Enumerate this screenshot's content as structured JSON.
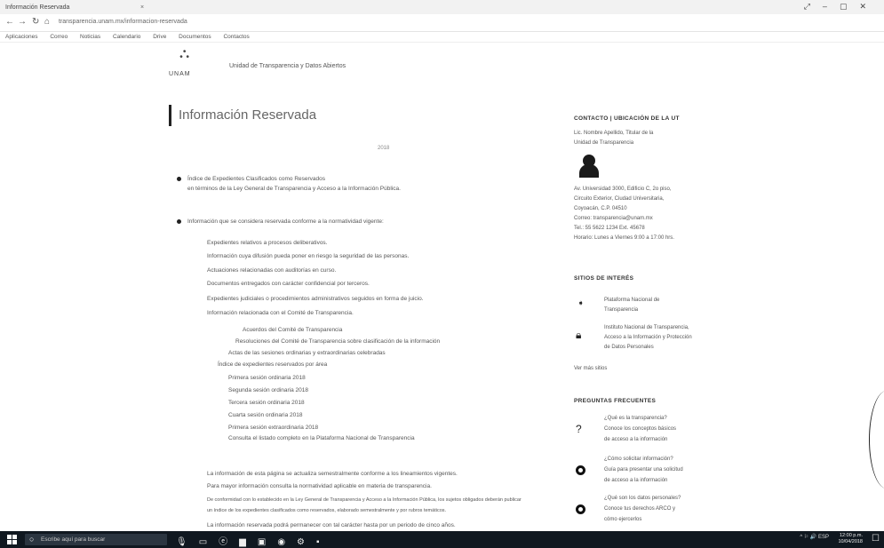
{
  "browser": {
    "tab_title": "Información Reservada",
    "tab_close": "×",
    "window_controls": [
      "⤢",
      "–",
      "▢",
      "✕"
    ],
    "nav": {
      "back": "←",
      "forward": "→",
      "reload": "↻",
      "home": "⌂"
    },
    "url": "transparencia.unam.mx/informacion-reservada",
    "bookmarks": [
      "Aplicaciones",
      "Correo",
      "Noticias",
      "Calendario",
      "Drive",
      "Documentos",
      "Contactos"
    ]
  },
  "header": {
    "logo_text": "UNAM",
    "site_title": "Unidad de Transparencia y Datos Abiertos"
  },
  "page": {
    "title": "Información Reservada",
    "date": "2018",
    "block1": [
      "Índice de Expedientes Clasificados como Reservados",
      "en términos de la Ley General de Transparencia y Acceso a la Información Pública."
    ],
    "block2": "Información que se considera reservada conforme a la normatividad vigente:",
    "lines": [
      "Expedientes relativos a procesos deliberativos.",
      "Información cuya difusión pueda poner en riesgo la seguridad de las personas.",
      "Actuaciones relacionadas con auditorías en curso.",
      "Documentos entregados con carácter confidencial por terceros.",
      "Expedientes judiciales o procedimientos administrativos seguidos en forma de juicio.",
      "Información relacionada con el Comité de Transparencia."
    ],
    "sub_lines": [
      "Acuerdos del Comité de Transparencia",
      "Resoluciones del Comité de Transparencia sobre clasificación de la información",
      "Actas de las sesiones ordinarias y extraordinarias celebradas",
      "Índice de expedientes reservados por área",
      "Primera sesión ordinaria 2018",
      "Segunda sesión ordinaria 2018",
      "Tercera sesión ordinaria 2018",
      "Cuarta sesión ordinaria 2018",
      "Primera sesión extraordinaria 2018",
      "Consulta el listado completo en la Plataforma Nacional de Transparencia"
    ],
    "footer_lines": [
      "La información de esta página se actualiza semestralmente conforme a los lineamientos vigentes.",
      "Para mayor información consulta la normatividad aplicable en materia de transparencia.",
      "De conformidad con lo establecido en la Ley General de Transparencia y Acceso a la Información Pública, los sujetos obligados deberán publicar",
      "un índice de los expedientes clasificados como reservados, elaborado semestralmente y por rubros temáticos.",
      "La información reservada podrá permanecer con tal carácter hasta por un periodo de cinco años."
    ]
  },
  "sidebar": {
    "contact_heading": "CONTACTO | UBICACIÓN DE LA UT",
    "contact_name": "Lic. Nombre Apellido, Titular de la",
    "contact_role": "Unidad de Transparencia",
    "contact_lines": [
      "Av. Universidad 3000, Edificio C, 2o piso,",
      "Circuito Exterior, Ciudad Universitaria,",
      "Coyoacán, C.P. 04510",
      "Correo: transparencia@unam.mx",
      "Tel.: 55 5622 1234 Ext. 45678",
      "Horario: Lunes a Viernes 9:00 a 17:00 hrs."
    ],
    "sites_heading": "SITIOS DE INTERÉS",
    "sites": [
      [
        "Plataforma Nacional de",
        "Transparencia"
      ],
      [
        "Instituto Nacional de Transparencia,",
        "Acceso a la Información y Protección",
        "de Datos Personales"
      ]
    ],
    "more": "Ver más sitios",
    "faq_heading": "PREGUNTAS FRECUENTES",
    "faqs": [
      [
        "¿Qué es la transparencia?",
        "Conoce los conceptos básicos",
        "de acceso a la información"
      ],
      [
        "¿Cómo solicitar información?",
        "Guía para presentar una solicitud",
        "de acceso a la información"
      ],
      [
        "¿Qué son los datos personales?",
        "Conoce tus derechos ARCO y",
        "cómo ejercerlos"
      ]
    ]
  },
  "taskbar": {
    "search_placeholder": "Escribe aquí para buscar",
    "tray": "^ ⚐ 🔊 ESP",
    "time": "12:00 p.m.",
    "date": "10/04/2018"
  }
}
